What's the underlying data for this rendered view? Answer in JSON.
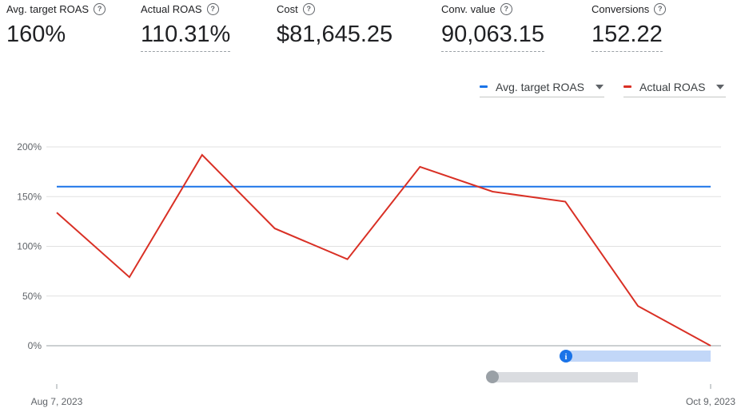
{
  "metrics": [
    {
      "label": "Avg. target ROAS",
      "value": "160%"
    },
    {
      "label": "Actual ROAS",
      "value": "110.31%"
    },
    {
      "label": "Cost",
      "value": "$81,645.25"
    },
    {
      "label": "Conv. value",
      "value": "90,063.15"
    },
    {
      "label": "Conversions",
      "value": "152.22"
    }
  ],
  "help_icon_glyph": "?",
  "legend": [
    {
      "label": "Avg. target ROAS",
      "color": "#1a73e8"
    },
    {
      "label": "Actual ROAS",
      "color": "#d93025"
    }
  ],
  "chart_data": {
    "type": "line",
    "x_labels": [
      "Aug 7, 2023",
      "Oct 9, 2023"
    ],
    "y_ticks": [
      "0%",
      "50%",
      "100%",
      "150%",
      "200%"
    ],
    "ylim": [
      0,
      200
    ],
    "series": [
      {
        "name": "Avg. target ROAS",
        "color": "#1a73e8",
        "values": [
          160,
          160,
          160,
          160,
          160,
          160,
          160,
          160,
          160,
          160
        ]
      },
      {
        "name": "Actual ROAS",
        "color": "#d93025",
        "values": [
          134,
          69,
          192,
          118,
          87,
          180,
          155,
          145,
          40,
          0
        ]
      }
    ],
    "grid": true
  },
  "annotation": {
    "icon_glyph": "i",
    "color": "#1a73e8",
    "bar_color": "#c2d7f8"
  },
  "range_slider": {
    "track_color": "#dadce0",
    "handle_color": "#9aa0a6"
  }
}
